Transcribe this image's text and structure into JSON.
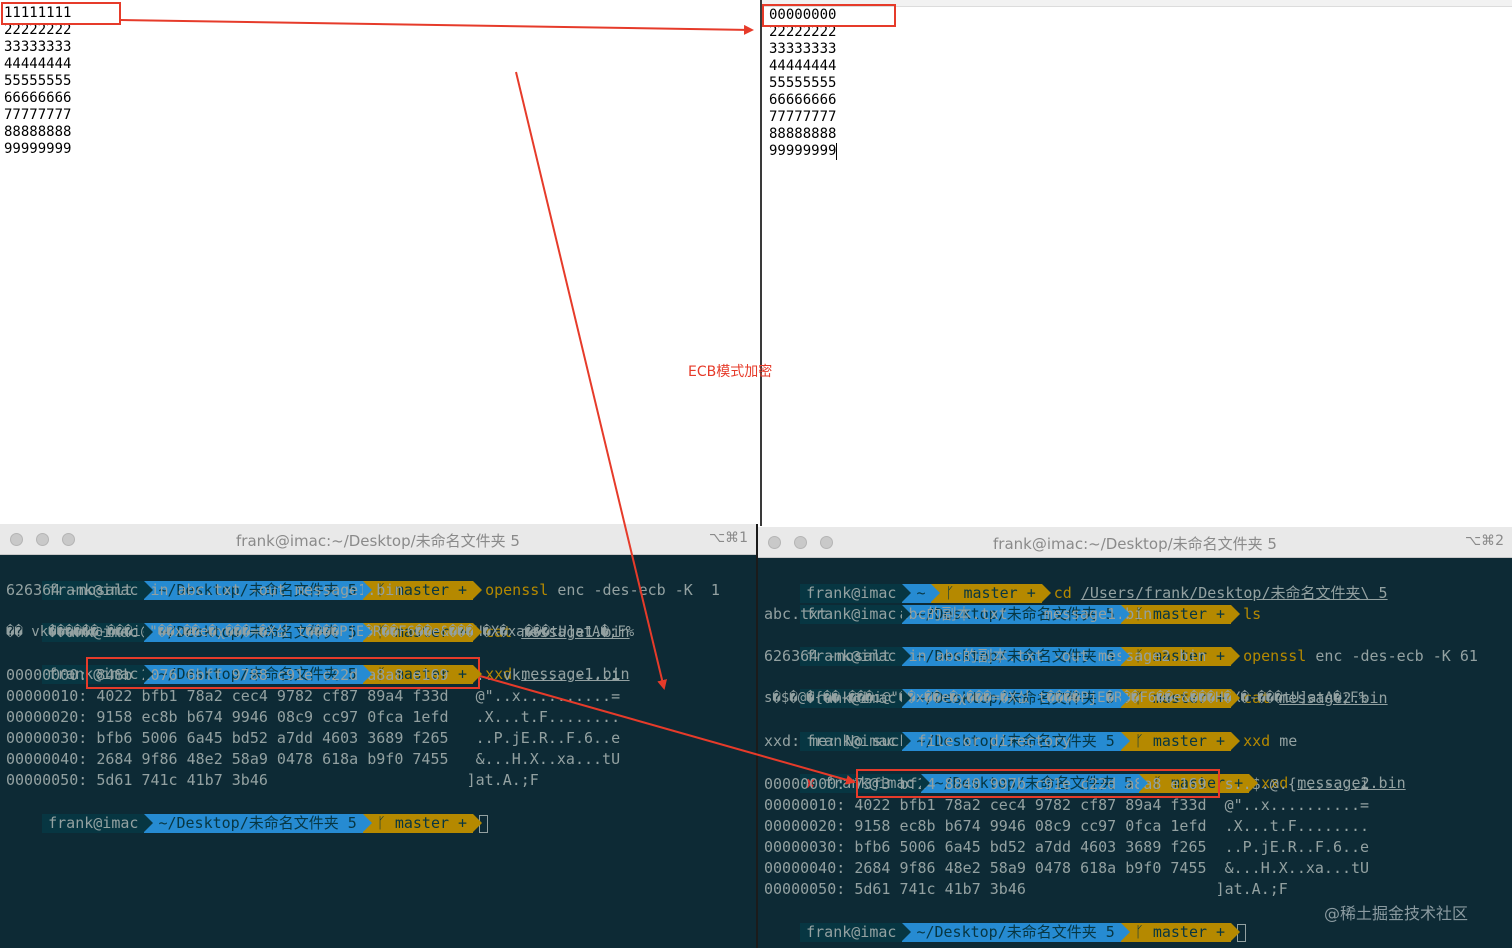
{
  "left_editor": {
    "lines": [
      "11111111",
      "22222222",
      "33333333",
      "44444444",
      "55555555",
      "66666666",
      "77777777",
      "88888888",
      "99999999"
    ]
  },
  "right_editor": {
    "lines": [
      "00000000",
      "22222222",
      "33333333",
      "44444444",
      "55555555",
      "66666666",
      "77777777",
      "88888888",
      "99999999"
    ]
  },
  "annotation": "ECB模式加密",
  "watermark": "@稀土掘金技术社区",
  "left_term": {
    "title": "frank@imac:~/Desktop/未命名文件夹 5",
    "shortcut": "⌥⌘1",
    "prompt": {
      "user": "frank@imac",
      "path": "~/Desktop/未命名文件夹 5",
      "branch": "master +"
    },
    "cmd1": {
      "name": "openssl",
      "args": "enc -des-ecb -K  1"
    },
    "cmd1_wrap": "626364 -nosalt -in abc.txt -out message1.bin",
    "cmd2": {
      "name": "cat",
      "args": "message1.bin"
    },
    "cat_out": "�� vk������-���i@\"��x��e�χ���=�X싮 t����PjE�R��F6��e&���H�X�xa���tU]atA�;F%",
    "cmd3": {
      "name": "xxd",
      "args": "message1.bin"
    },
    "hex": [
      {
        "off": "00000000:",
        "hex": "848b 2076 6bff 9788 c91e c22d a8a8 e169",
        "asc": ".. vk......-...i"
      },
      {
        "off": "00000010:",
        "hex": "4022 bfb1 78a2 cec4 9782 cf87 89a4 f33d",
        "asc": "@\"..x..........="
      },
      {
        "off": "00000020:",
        "hex": "9158 ec8b b674 9946 08c9 cc97 0fca 1efd",
        "asc": ".X...t.F........"
      },
      {
        "off": "00000030:",
        "hex": "bfb6 5006 6a45 bd52 a7dd 4603 3689 f265",
        "asc": "..P.jE.R..F.6..e"
      },
      {
        "off": "00000040:",
        "hex": "2684 9f86 48e2 58a9 0478 618a b9f0 7455",
        "asc": "&...H.X..xa...tU"
      },
      {
        "off": "00000050:",
        "hex": "5d61 741c 41b7 3b46",
        "asc": "]at.A.;F"
      }
    ]
  },
  "right_term": {
    "title": "frank@imac:~/Desktop/未命名文件夹 5",
    "shortcut": "⌥⌘2",
    "prompt": {
      "user": "frank@imac",
      "home": "~",
      "path": "~/Desktop/未命名文件夹 5",
      "branch": "master +"
    },
    "cmd1": {
      "name": "cd",
      "args": "/Users/frank/Desktop/未命名文件夹\\ 5"
    },
    "cmd2": {
      "name": "ls",
      "args": ""
    },
    "ls_out": "abc.txt        abc的副本.txt    message1.bin",
    "cmd3": {
      "name": "openssl",
      "args": "enc -des-ecb -K 61"
    },
    "cmd3_wrap": "626364 -nosalt -in abc的副本.txt -out message2.bin",
    "cmd4": {
      "name": "cat",
      "args": "message2.bin"
    },
    "cat_out": "s�$�@�{��-���i@\"��x��e�χ���=�X싮 t����PjE�R��F6��e&���H�X�-���tU]atA�;F%",
    "cmd5": {
      "name": "xxd",
      "args": "me"
    },
    "err": "xxd: me: No such file or directory",
    "cmd6": {
      "name": "xxd",
      "args": "message2.bin"
    },
    "err_mark": "✘",
    "hex": [
      {
        "off": "00000000:",
        "hex": "73f3 bf24 8840 997b c91e c22d a8a8 e169",
        "asc": "s..$.@.{...-...i"
      },
      {
        "off": "00000010:",
        "hex": "4022 bfb1 78a2 cec4 9782 cf87 89a4 f33d",
        "asc": "@\"..x..........="
      },
      {
        "off": "00000020:",
        "hex": "9158 ec8b b674 9946 08c9 cc97 0fca 1efd",
        "asc": ".X...t.F........"
      },
      {
        "off": "00000030:",
        "hex": "bfb6 5006 6a45 bd52 a7dd 4603 3689 f265",
        "asc": "..P.jE.R..F.6..e"
      },
      {
        "off": "00000040:",
        "hex": "2684 9f86 48e2 58a9 0478 618a b9f0 7455",
        "asc": "&...H.X..xa...tU"
      },
      {
        "off": "00000050:",
        "hex": "5d61 741c 41b7 3b46",
        "asc": "]at.A.;F"
      }
    ]
  },
  "colors": {
    "annotation_red": "#e63b2a",
    "terminal_bg": "#0d2a35"
  }
}
